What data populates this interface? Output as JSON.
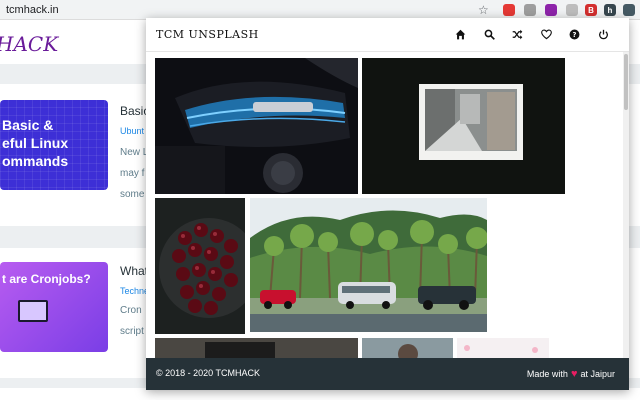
{
  "browser": {
    "url": "tcmhack.in",
    "extensions": [
      {
        "name": "red-ext-icon",
        "color": "#e53935",
        "glyph": ""
      },
      {
        "name": "globe-ext-icon",
        "color": "#9e9e9e",
        "glyph": ""
      },
      {
        "name": "purple-ext-icon",
        "color": "#8e24aa",
        "glyph": ""
      },
      {
        "name": "ghost-ext-icon",
        "color": "#bdbdbd",
        "glyph": ""
      },
      {
        "name": "red-square-ext-icon",
        "color": "#d32f2f",
        "glyph": "B"
      },
      {
        "name": "h-ext-icon",
        "color": "#37474f",
        "glyph": "h"
      },
      {
        "name": "tcm-ext-icon",
        "color": "#455a64",
        "glyph": ""
      }
    ]
  },
  "site": {
    "logo": "HACK",
    "posts": [
      {
        "thumb_text": "Basic &\neful Linux\nommands",
        "title": "Basic",
        "category": "Ubunt",
        "excerpt": [
          "New L",
          "may f",
          "some"
        ]
      },
      {
        "thumb_text": "t are Cronjobs?",
        "title": "What",
        "category": "Techne",
        "excerpt": [
          "Cron",
          "script"
        ]
      }
    ]
  },
  "popup": {
    "title": "TCM UNSPLASH",
    "nav": [
      {
        "name": "home-icon",
        "label": "Home"
      },
      {
        "name": "search-icon",
        "label": "Search"
      },
      {
        "name": "shuffle-icon",
        "label": "Random"
      },
      {
        "name": "heart-icon",
        "label": "Favorites"
      },
      {
        "name": "help-icon",
        "label": "Help"
      },
      {
        "name": "power-icon",
        "label": "Quit"
      }
    ],
    "footer": {
      "copyright": "© 2018 - 2020 TCMHACK",
      "made_with": "Made with",
      "location": "at Jaipur"
    }
  },
  "colors": {
    "footer_bg": "#263238",
    "accent_purple": "#6a1b9a",
    "heart": "#e91e63"
  }
}
